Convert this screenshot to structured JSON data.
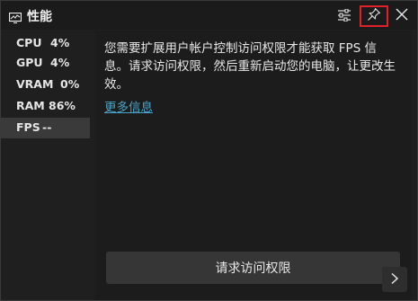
{
  "window": {
    "title": "性能",
    "icons": {
      "app": "performance-monitor-icon",
      "settings": "sliders-icon",
      "pin": "pin-icon",
      "close": "close-icon",
      "next": "chevron-right-icon"
    },
    "highlight_color": "#e0202a"
  },
  "sidebar": {
    "items": [
      {
        "label": "CPU",
        "value": "4%",
        "selected": false
      },
      {
        "label": "GPU",
        "value": "4%",
        "selected": false
      },
      {
        "label": "VRAM",
        "value": "0%",
        "selected": false
      },
      {
        "label": "RAM",
        "value": "86%",
        "selected": false
      },
      {
        "label": "FPS",
        "value": "--",
        "selected": true
      }
    ]
  },
  "content": {
    "message": "您需要扩展用户帐户控制访问权限才能获取 FPS 信息。请求访问权限，然后重新启动您的电脑，让更改生效。",
    "more_info_link": "更多信息",
    "request_button": "请求访问权限",
    "link_color": "#4aa3c7"
  }
}
